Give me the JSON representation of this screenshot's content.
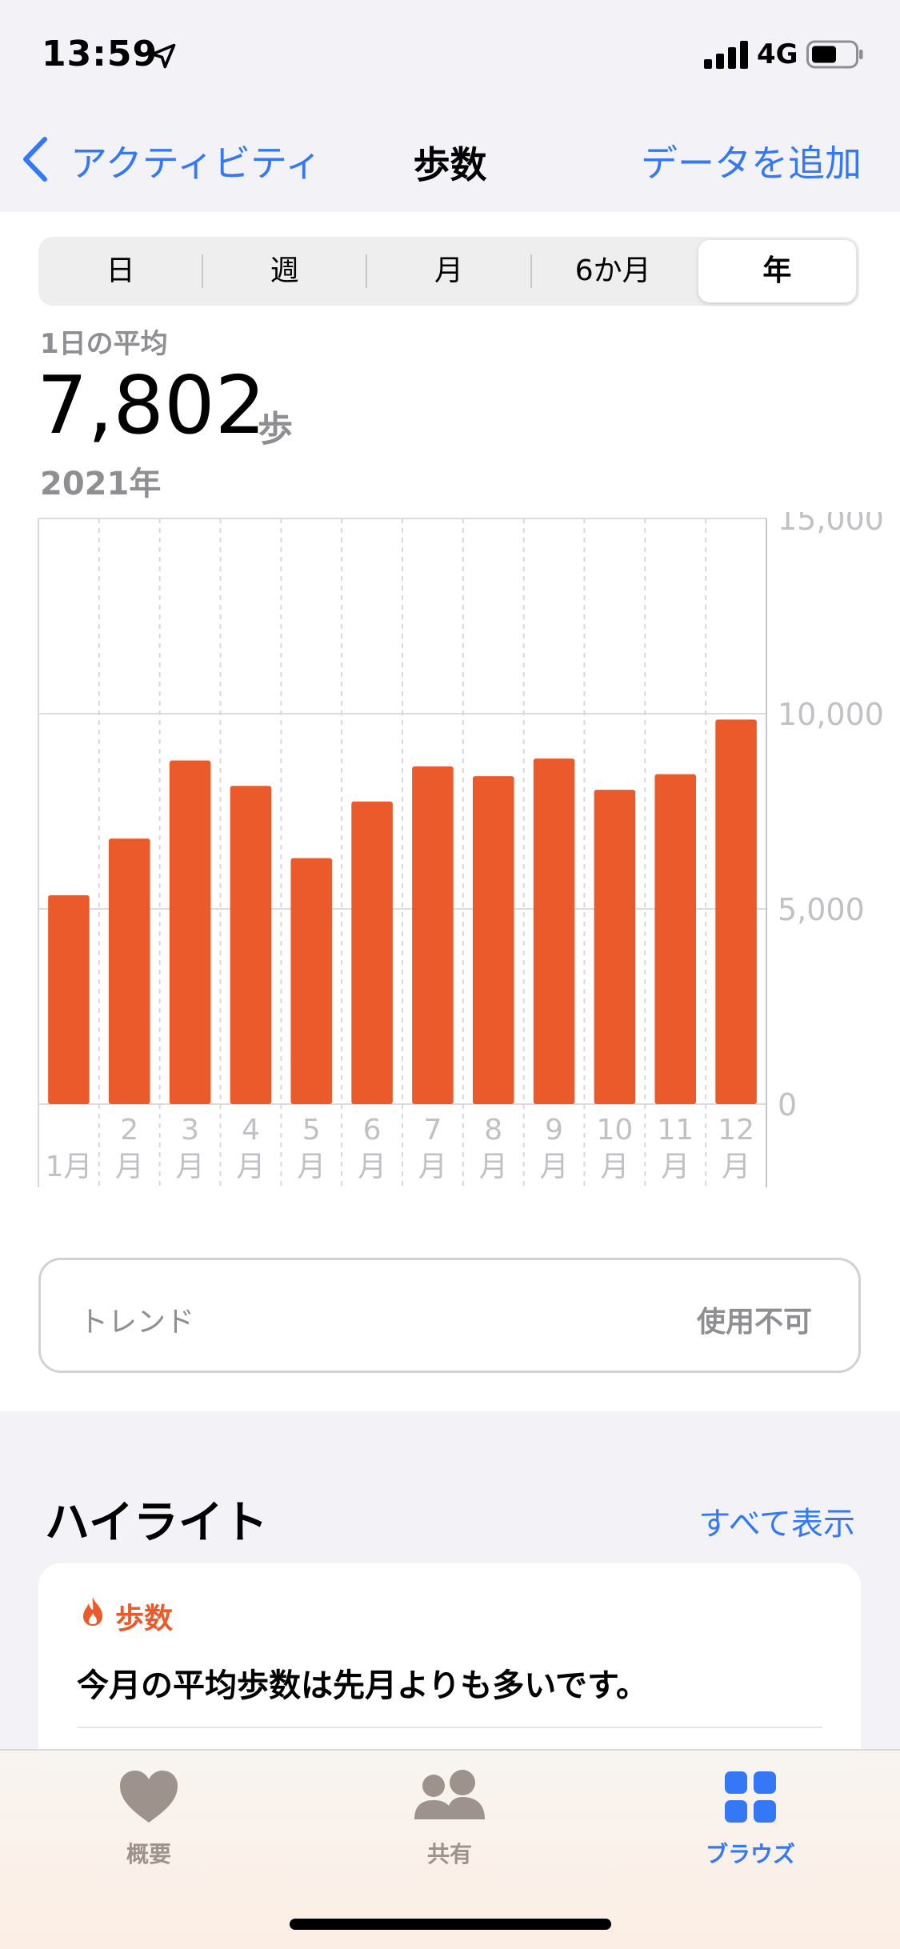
{
  "status_bar": {
    "time": "13:59",
    "network": "4G"
  },
  "nav": {
    "back_label": "アクティビティ",
    "title": "歩数",
    "action_label": "データを追加"
  },
  "segments": [
    {
      "label": "日",
      "selected": false
    },
    {
      "label": "週",
      "selected": false
    },
    {
      "label": "月",
      "selected": false
    },
    {
      "label": "6か月",
      "selected": false
    },
    {
      "label": "年",
      "selected": true
    }
  ],
  "summary": {
    "label": "1日の平均",
    "value": "7,802",
    "unit": "歩",
    "period": "2021年"
  },
  "chart_data": {
    "type": "bar",
    "categories": [
      "1月",
      "2月",
      "3月",
      "4月",
      "5月",
      "6月",
      "7月",
      "8月",
      "9月",
      "10月",
      "11月",
      "12月"
    ],
    "category_lines": [
      [
        "1月"
      ],
      [
        "2",
        "月"
      ],
      [
        "3",
        "月"
      ],
      [
        "4",
        "月"
      ],
      [
        "5",
        "月"
      ],
      [
        "6",
        "月"
      ],
      [
        "7",
        "月"
      ],
      [
        "8",
        "月"
      ],
      [
        "9",
        "月"
      ],
      [
        "10",
        "月"
      ],
      [
        "11",
        "月"
      ],
      [
        "12",
        "月"
      ]
    ],
    "values": [
      5350,
      6800,
      8800,
      8150,
      6300,
      7750,
      8650,
      8400,
      8850,
      8050,
      8450,
      9850
    ],
    "ylim": [
      0,
      15000
    ],
    "yticks": [
      "0",
      "5,000",
      "10,000",
      "15,000"
    ],
    "ytick_values": [
      0,
      5000,
      10000,
      15000
    ],
    "bar_color": "#eb5a2b",
    "grid": true
  },
  "trend": {
    "label": "トレンド",
    "value": "使用不可"
  },
  "highlights": {
    "title": "ハイライト",
    "see_all": "すべて表示",
    "card": {
      "category": "歩数",
      "text": "今月の平均歩数は先月よりも多いです。"
    }
  },
  "tab_bar": {
    "tabs": [
      {
        "label": "概要",
        "icon": "heart-icon",
        "active": false
      },
      {
        "label": "共有",
        "icon": "people-icon",
        "active": false
      },
      {
        "label": "ブラウズ",
        "icon": "grid-icon",
        "active": true
      }
    ],
    "active_color": "#3478f6",
    "inactive_color": "#8e8e93"
  }
}
